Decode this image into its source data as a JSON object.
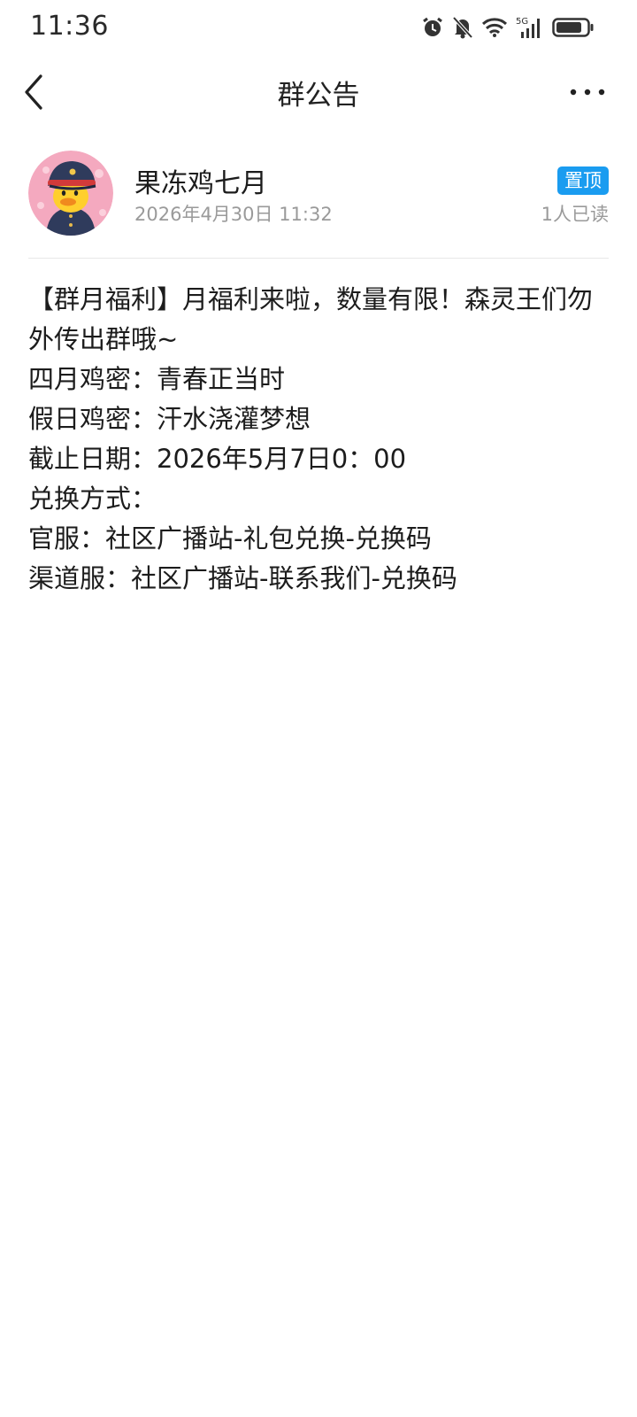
{
  "status_bar": {
    "time": "11:36",
    "icons": [
      "alarm-icon",
      "mute-bell-icon",
      "wifi-icon",
      "signal-5g-icon",
      "battery-icon"
    ],
    "network": "5G"
  },
  "header": {
    "title": "群公告",
    "back_icon": "chevron-left-icon",
    "more_icon": "more-dots-icon"
  },
  "announcement": {
    "author": "果冻鸡七月",
    "timestamp": "2026年4月30日 11:32",
    "badge": "置顶",
    "read_status": "1人已读",
    "lines": [
      "【群月福利】月福利来啦，数量有限！森灵王们勿外传出群哦~",
      "四月鸡密：青春正当时",
      "假日鸡密：汗水浇灌梦想",
      "截止日期：2026年5月7日0：00",
      "兑换方式：",
      "官服：社区广播站-礼包兑换-兑换码",
      "渠道服：社区广播站-联系我们-兑换码"
    ]
  },
  "colors": {
    "badge_bg": "#1a9cf0",
    "secondary_text": "#9a9a9a"
  }
}
